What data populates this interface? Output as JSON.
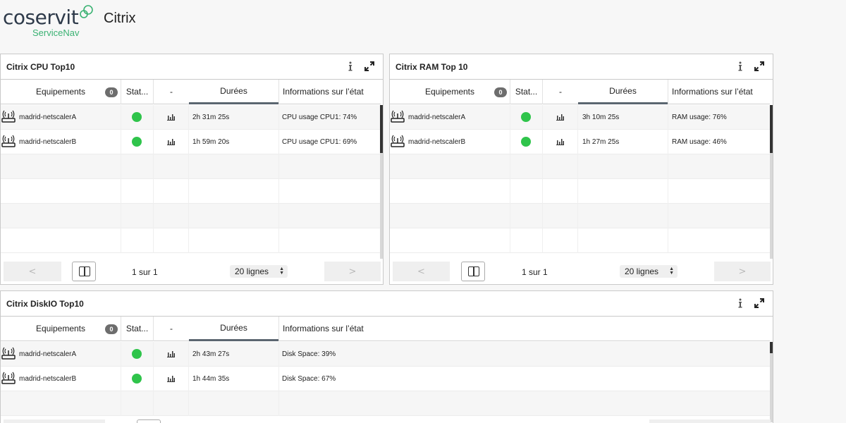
{
  "header": {
    "logo_text": "coservit",
    "logo_sub": "ServiceNav",
    "page_title": "Citrix"
  },
  "columns": {
    "equipements": "Equipements",
    "count_badge": "0",
    "status": "Stat...",
    "graph": "-",
    "durees": "Durées",
    "info": "Informations sur l’état"
  },
  "status_color": "#2fc44b",
  "panels": {
    "cpu": {
      "title": "Citrix CPU Top10",
      "rows": [
        {
          "device": "madrid-netscalerA",
          "duration": "2h 31m 25s",
          "info": "CPU usage CPU1: 74%"
        },
        {
          "device": "madrid-netscalerB",
          "duration": "1h 59m 20s",
          "info": "CPU usage CPU1: 69%"
        }
      ],
      "pager": {
        "prev": "<",
        "next": ">",
        "page": "1 sur 1",
        "lines": "20 lignes"
      }
    },
    "ram": {
      "title": "Citrix RAM Top 10",
      "rows": [
        {
          "device": "madrid-netscalerA",
          "duration": "3h 10m 25s",
          "info": "RAM usage: 76%"
        },
        {
          "device": "madrid-netscalerB",
          "duration": "1h 27m 25s",
          "info": "RAM usage: 46%"
        }
      ],
      "pager": {
        "prev": "<",
        "next": ">",
        "page": "1 sur 1",
        "lines": "20 lignes"
      }
    },
    "disk": {
      "title": "Citrix DiskIO Top10",
      "rows": [
        {
          "device": "madrid-netscalerA",
          "duration": "2h 43m 27s",
          "info": "Disk Space: 39%"
        },
        {
          "device": "madrid-netscalerB",
          "duration": "1h 44m 35s",
          "info": "Disk Space: 67%"
        }
      ]
    }
  }
}
